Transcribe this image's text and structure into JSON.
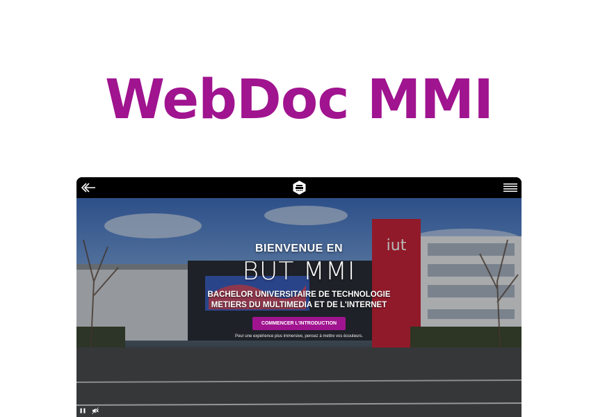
{
  "page": {
    "title": "WebDoc MMI"
  },
  "colors": {
    "accent": "#a0148f",
    "topbar": "#000000",
    "text_light": "#ffffff"
  },
  "topbar": {
    "back_icon": "back-arrow-icon",
    "logo_icon": "iut-logo-icon",
    "menu_icon": "hamburger-menu-icon"
  },
  "hero": {
    "welcome": "BIENVENUE EN",
    "program": "BUT MMI",
    "subtitle_line1": "BACHELOR UNIVERSITAIRE DE TECHNOLOGIE",
    "subtitle_line2": "METIERS DU MULTIMEDIA ET DE L'INTERNET",
    "cta_label": "COMMENCER L'INTRODUCTION",
    "hint": "Pour une expérience plus immersive, pensez à mettre vos écouteurs.",
    "building_sign": "iut"
  },
  "player": {
    "pause_icon": "pause-icon",
    "mute_icon": "sound-muted-icon"
  }
}
